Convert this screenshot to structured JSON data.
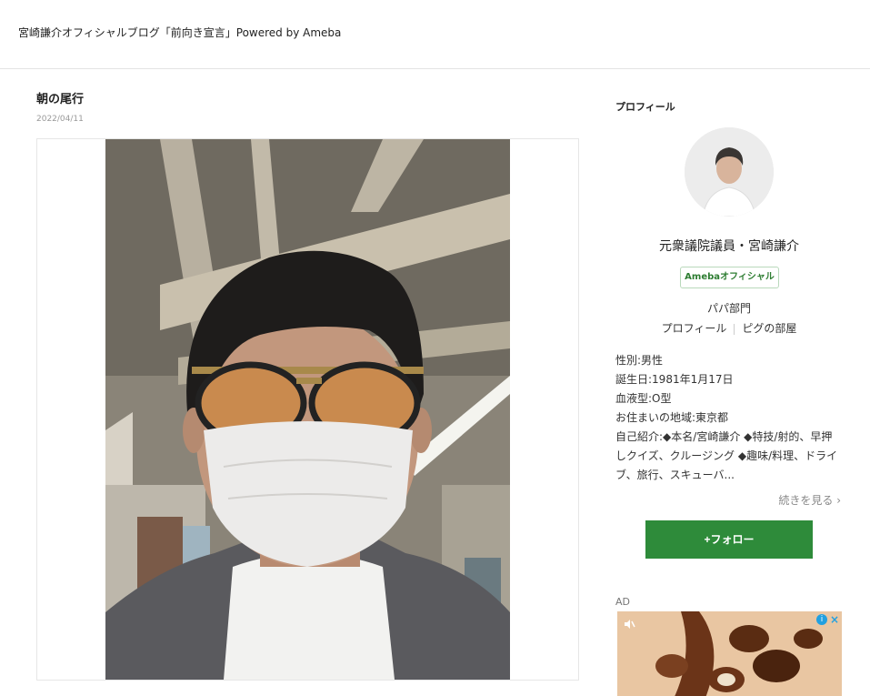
{
  "header": {
    "blog_title": "宮崎謙介オフィシャルブログ「前向き宣言」Powered by Ameba"
  },
  "article": {
    "title": "朝の尾行",
    "date": "2022/04/11"
  },
  "sidebar": {
    "heading": "プロフィール",
    "name": "元衆議院議員・宮崎謙介",
    "badge": "Amebaオフィシャル",
    "genre": "パパ部門",
    "links": [
      "プロフィール",
      "ピグの部屋"
    ],
    "info": [
      "性別:男性",
      "誕生日:1981年1月17日",
      "血液型:O型",
      "お住まいの地域:東京都",
      "自己紹介:◆本名/宮崎謙介 ◆特技/射的、早押しクイズ、クルージング ◆趣味/料理、ドライブ、旅行、スキューバ..."
    ],
    "more_label": "続きを見る",
    "follow_label": "+フォロー",
    "ad_label": "AD"
  },
  "colors": {
    "follow_green": "#2e8b3a",
    "badge_green": "#2e7d32",
    "divider": "#e3e3e3"
  }
}
